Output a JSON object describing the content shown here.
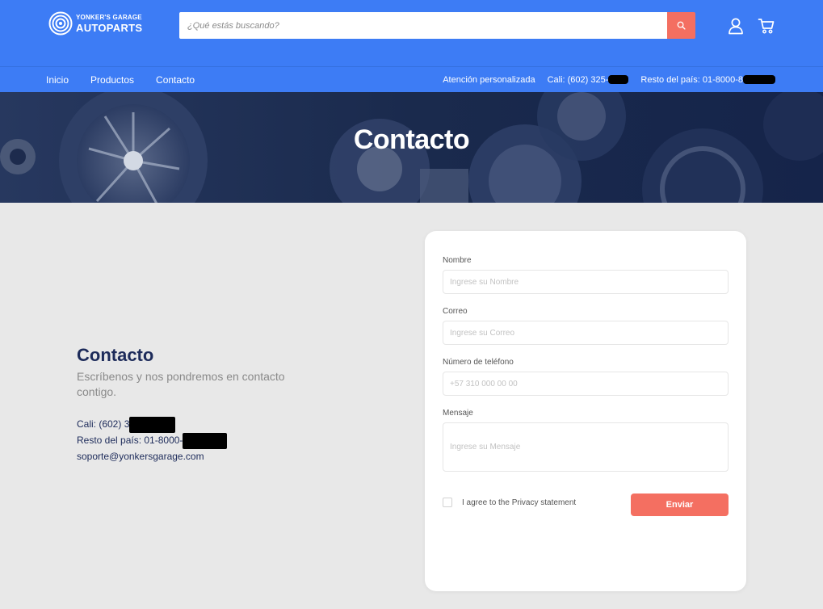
{
  "header": {
    "logo_line1": "YONKER'S GARAGE",
    "logo_line2": "AUTOPARTS",
    "search_placeholder": "¿Qué estás buscando?"
  },
  "nav": {
    "links": [
      "Inicio",
      "Productos",
      "Contacto"
    ],
    "attention": "Atención personalizada",
    "phone_cali": "Cali: (602) 325-",
    "phone_rest": "Resto del país: 01-8000-8"
  },
  "hero": {
    "title": "Contacto"
  },
  "info": {
    "title": "Contacto",
    "subtitle": "Escríbenos y nos pondremos en contacto contigo.",
    "cali": "Cali: (602) 3",
    "rest": "Resto del país: 01-8000-",
    "email": "soporte@yonkersgarage.com"
  },
  "form": {
    "name_label": "Nombre",
    "name_placeholder": "Ingrese su Nombre",
    "email_label": "Correo",
    "email_placeholder": "Ingrese su Correo",
    "phone_label": "Número de teléfono",
    "phone_placeholder": "+57 310 000 00 00",
    "message_label": "Mensaje",
    "message_placeholder": "Ingrese su Mensaje",
    "agree_label": "I agree to the Privacy statement",
    "submit_label": "Enviar"
  },
  "colors": {
    "brand_blue": "#3d7cf5",
    "accent_coral": "#f46f61",
    "navy_text": "#1d2b5a",
    "page_bg": "#e8e8e8"
  },
  "icons": {
    "search": "search-icon",
    "user": "user-icon",
    "cart": "cart-icon",
    "logo": "target-logo-icon"
  }
}
